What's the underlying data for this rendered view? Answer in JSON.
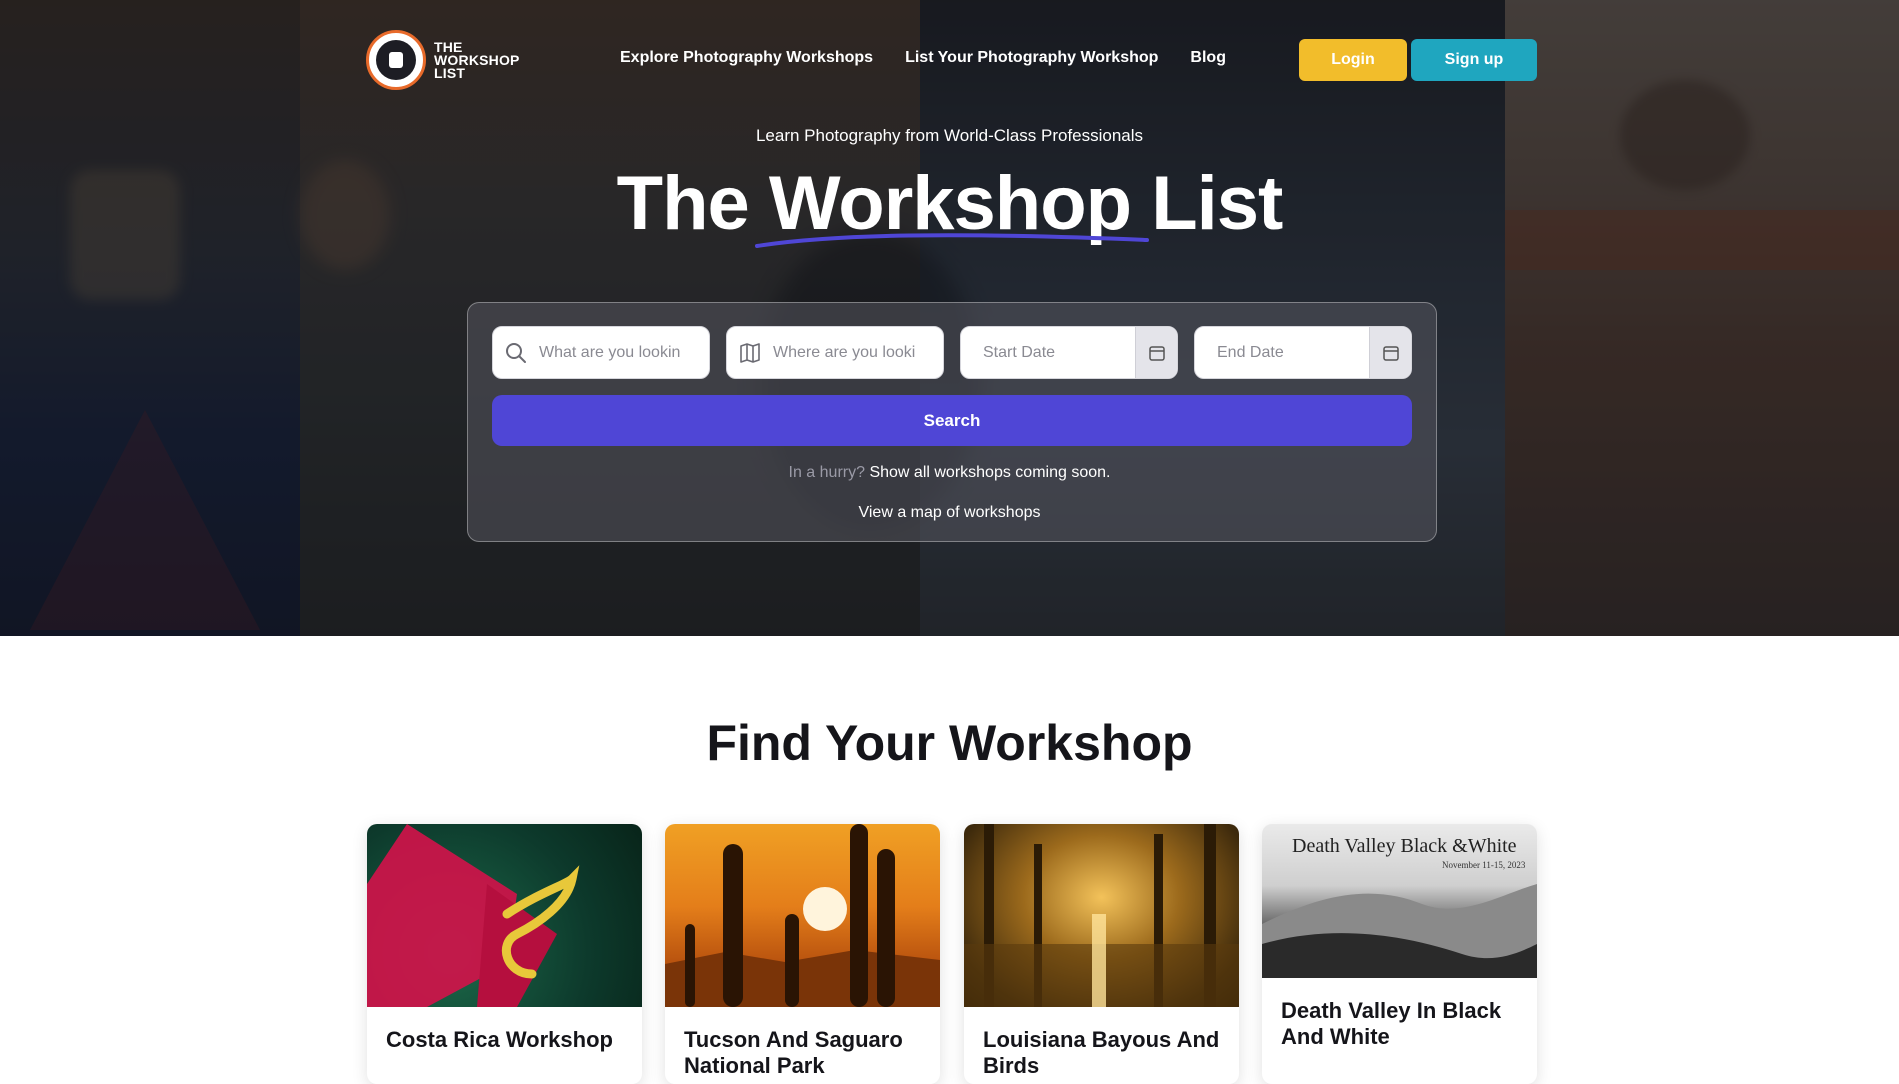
{
  "logo": {
    "line1": "THE",
    "line2": "WORKSHOP",
    "line3": "LIST"
  },
  "nav": {
    "links": [
      "Explore Photography Workshops",
      "List Your Photography Workshop",
      "Blog"
    ],
    "login": "Login",
    "signup": "Sign up"
  },
  "hero": {
    "tagline": "Learn Photography from World-Class Professionals",
    "title_pre": "The ",
    "title_highlight": "Workshop",
    "title_post": " List"
  },
  "search": {
    "what_placeholder": "What are you lookin",
    "where_placeholder": "Where are you looki",
    "start_placeholder": "Start Date",
    "end_placeholder": "End Date",
    "button": "Search",
    "hurry_muted": "In a hurry? ",
    "hurry_link": "Show all workshops coming soon.",
    "map_link": "View a map of workshops"
  },
  "section": {
    "title": "Find Your Workshop"
  },
  "cards": [
    {
      "title": "Costa Rica Workshop"
    },
    {
      "title": "Tucson And Saguaro National Park"
    },
    {
      "title": "Louisiana Bayous And Birds"
    },
    {
      "title": "Death Valley In Black And White",
      "image_title": "Death Valley Black &White",
      "image_date": "November 11-15, 2023"
    }
  ],
  "colors": {
    "accent": "#4f46d6",
    "login": "#f2bd2b",
    "signup": "#1fa6bf",
    "logo_ring": "#e86a2a"
  }
}
